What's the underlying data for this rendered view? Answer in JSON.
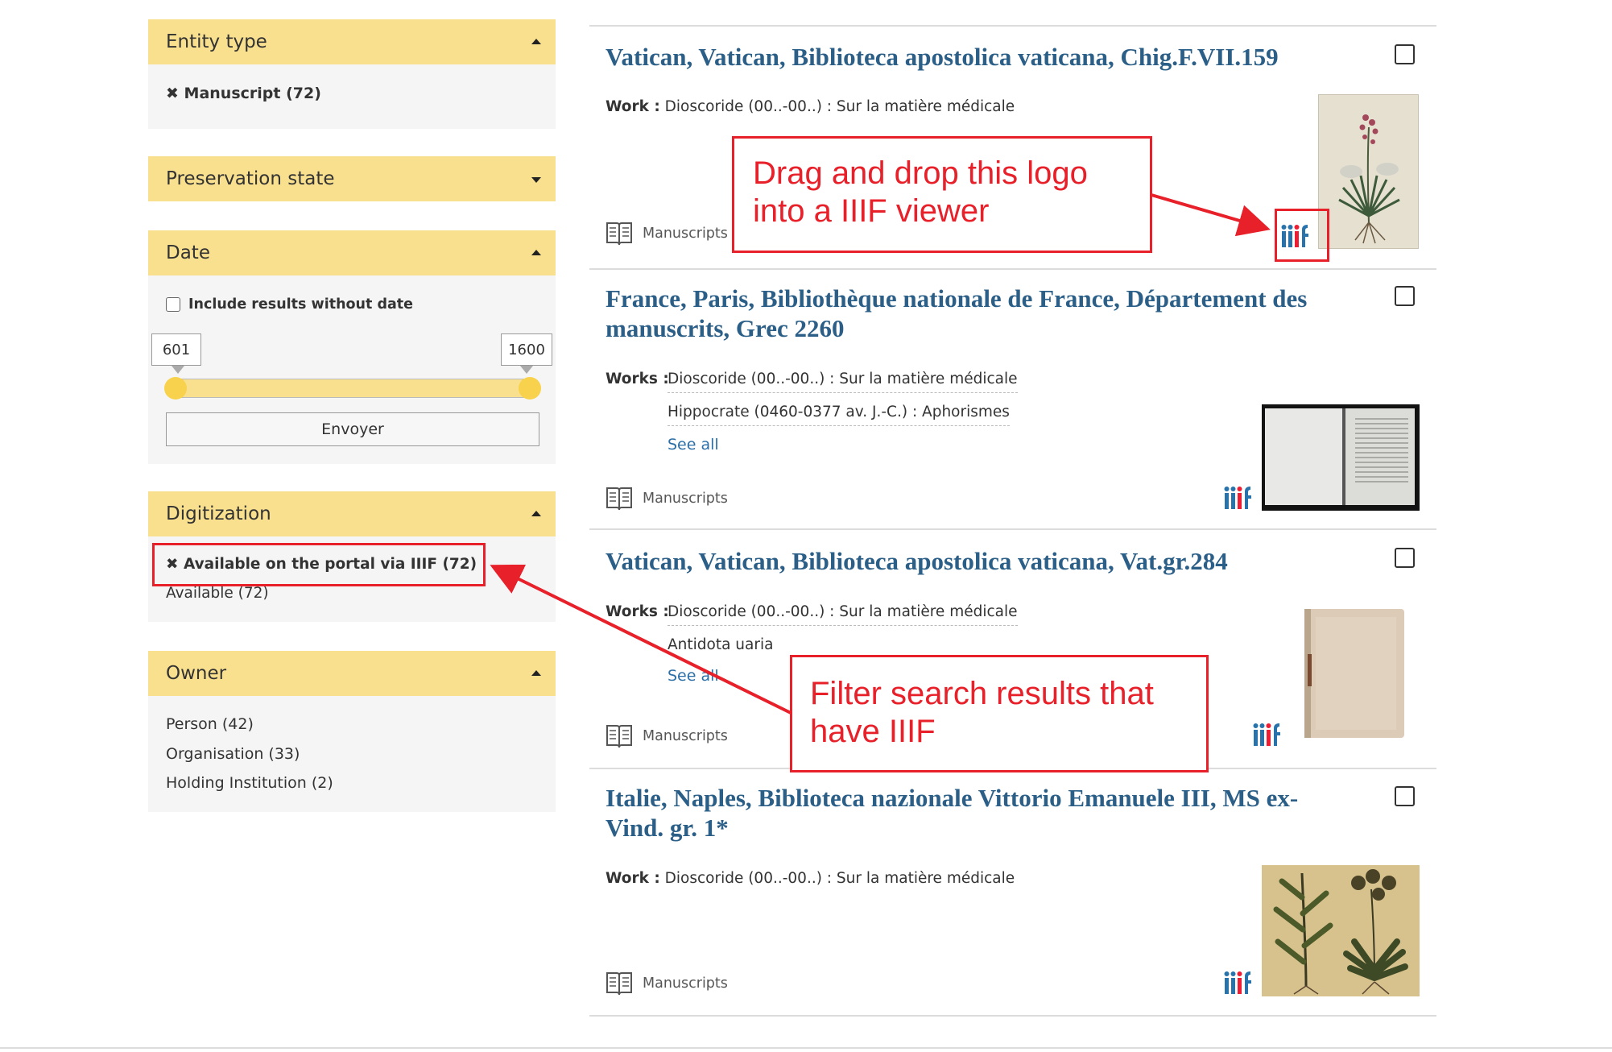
{
  "facets": {
    "entity_type": {
      "title": "Entity type",
      "active_filter": "Manuscript (72)",
      "remove_glyph": "✖"
    },
    "preservation_state": {
      "title": "Preservation state"
    },
    "date": {
      "title": "Date",
      "include_without_date": "Include results without date",
      "range_min": "601",
      "range_max": "1600",
      "submit_label": "Envoyer"
    },
    "digitization": {
      "title": "Digitization",
      "active_filter": "Available on the portal via IIIF (72)",
      "remove_glyph": "✖",
      "option": "Available (72)"
    },
    "owner": {
      "title": "Owner",
      "options": [
        "Person (42)",
        "Organisation (33)",
        "Holding Institution (2)"
      ]
    }
  },
  "results": [
    {
      "title_lines": [
        "Vatican, Vatican, Biblioteca apostolica vaticana, Chig.F.VII.159"
      ],
      "works_label": "Work :",
      "works": [
        "Dioscoride (00..-00..) : Sur la matière médicale"
      ],
      "see_all": "",
      "type_label": "Manuscripts"
    },
    {
      "title_lines": [
        "France, Paris, Bibliothèque nationale de France, Département des",
        "manuscrits, Grec 2260"
      ],
      "works_label": "Works :",
      "works": [
        "Dioscoride (00..-00..) : Sur la matière médicale",
        "Hippocrate (0460-0377 av. J.-C.) : Aphorismes"
      ],
      "see_all": "See all",
      "type_label": "Manuscripts"
    },
    {
      "title_lines": [
        "Vatican, Vatican, Biblioteca apostolica vaticana, Vat.gr.284"
      ],
      "works_label": "Works :",
      "works": [
        "Dioscoride (00..-00..) : Sur la matière médicale",
        "Antidota uaria"
      ],
      "see_all": "See all",
      "type_label": "Manuscripts"
    },
    {
      "title_lines": [
        "Italie, Naples, Biblioteca nazionale Vittorio Emanuele III, MS ex-",
        "Vind. gr. 1*"
      ],
      "works_label": "Work :",
      "works": [
        "Dioscoride (00..-00..) : Sur la matière médicale"
      ],
      "see_all": "",
      "type_label": "Manuscripts"
    }
  ],
  "iiif_logo_text": "iiif",
  "annotations": {
    "drag_drop": [
      "Drag and drop this logo",
      "into a IIIF viewer"
    ],
    "filter": [
      "Filter search results that",
      "have IIIF"
    ]
  },
  "colors": {
    "facet_header": "#f9e08f",
    "facet_body": "#f5f5f5",
    "title_link": "#2b5f87",
    "link": "#2b6fa8",
    "annotation": "#e8202a",
    "iiif_blue": "#2873ab",
    "iiif_red": "#ed1d33"
  },
  "icons": {
    "manuscript": "open-book-icon",
    "iiif": "iiif-logo",
    "remove": "close-icon"
  }
}
